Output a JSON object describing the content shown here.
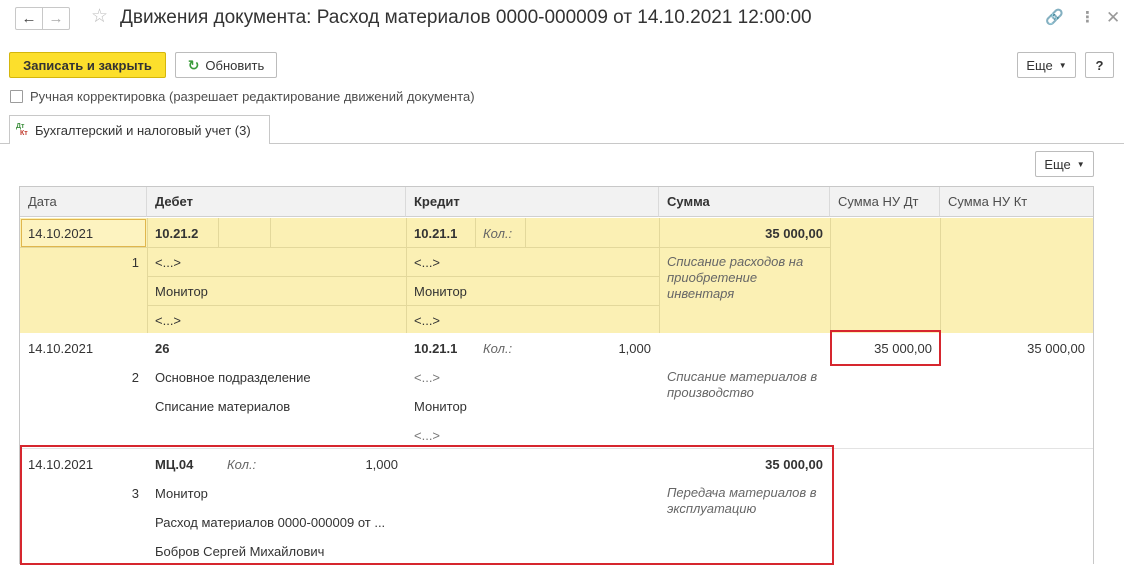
{
  "window": {
    "title": "Движения документа: Расход материалов 0000-000009 от 14.10.2021 12:00:00"
  },
  "toolbar": {
    "save_close": "Записать и закрыть",
    "refresh": "Обновить",
    "more": "Еще",
    "help": "?"
  },
  "manual_correction": {
    "label": "Ручная корректировка (разрешает редактирование движений документа)"
  },
  "tab": {
    "label": "Бухгалтерский и налоговый учет (3)",
    "icon_top": "Дт",
    "icon_bottom": "Кт"
  },
  "grid": {
    "more": "Еще",
    "columns": [
      "Дата",
      "Дебет",
      "Кредит",
      "Сумма",
      "Сумма НУ Дт",
      "Сумма НУ Кт"
    ],
    "rows": [
      {
        "date": "14.10.2021",
        "num": "1",
        "debit": [
          "10.21.2",
          "<...>",
          "Монитор",
          "<...>"
        ],
        "debit_qty_label": "",
        "debit_qty": "",
        "credit": [
          "10.21.1",
          "<...>",
          "Монитор",
          "<...>"
        ],
        "credit_qty_label": "Кол.:",
        "credit_qty": "",
        "sum": "35 000,00",
        "content": "Списание расходов на приобретение инвентаря",
        "nu_dt": "",
        "nu_kt": ""
      },
      {
        "date": "14.10.2021",
        "num": "2",
        "debit": [
          "26",
          "Основное подразделение",
          "Списание материалов"
        ],
        "credit": [
          "10.21.1",
          "<...>",
          "Монитор",
          "<...>"
        ],
        "credit_qty_label": "Кол.:",
        "credit_qty": "1,000",
        "sum": "",
        "content": "Списание материалов в производство",
        "nu_dt": "35 000,00",
        "nu_kt": "35 000,00"
      },
      {
        "date": "14.10.2021",
        "num": "3",
        "debit": [
          "МЦ.04",
          "Монитор",
          "Расход материалов 0000-000009 от ...",
          "Бобров Сергей Михайлович"
        ],
        "debit_qty_label": "Кол.:",
        "debit_qty": "1,000",
        "sum": "35 000,00",
        "content": "Передача материалов в эксплуатацию",
        "nu_dt": "",
        "nu_kt": ""
      }
    ]
  }
}
